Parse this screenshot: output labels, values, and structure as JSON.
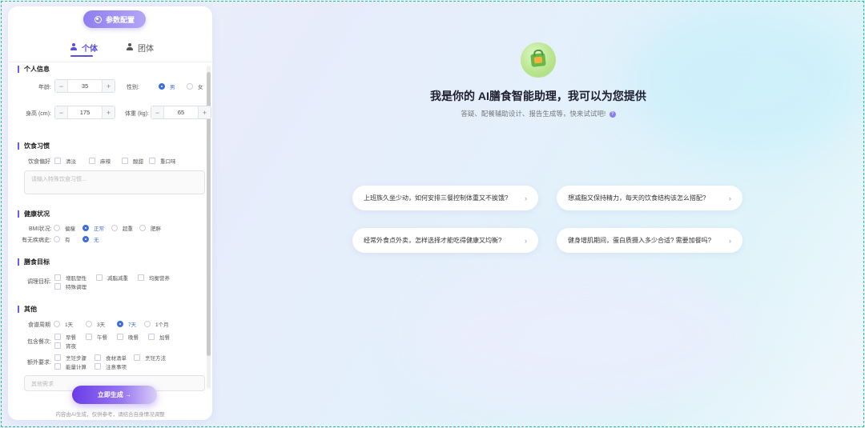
{
  "panel": {
    "param_button": "参数配置",
    "tabs": [
      {
        "label": "个体"
      },
      {
        "label": "团体"
      }
    ],
    "sections": {
      "personal": {
        "title": "个人信息",
        "age_label": "年龄:",
        "age_value": "35",
        "gender_label": "性别:",
        "gender_options": [
          "男",
          "女"
        ],
        "gender_selected": "男",
        "height_label": "身高 (cm):",
        "height_value": "175",
        "weight_label": "体重 (kg):",
        "weight_value": "65"
      },
      "diet": {
        "title": "饮食习惯",
        "pref_label": "饮食偏好",
        "pref_options": [
          "清淡",
          "麻辣",
          "酸甜",
          "重口味"
        ],
        "textarea_placeholder": "请输入特殊饮食习惯..."
      },
      "health": {
        "title": "健康状况",
        "bmi_label": "BMI状况:",
        "bmi_options": [
          "偏瘦",
          "正常",
          "超重",
          "肥胖"
        ],
        "bmi_selected": "正常",
        "disease_label": "有无疾病史:",
        "disease_options": [
          "有",
          "无"
        ],
        "disease_selected": "无"
      },
      "goal": {
        "title": "膳食目标",
        "adjust_label": "调理目标:",
        "options": [
          "增肌塑性",
          "减脂减重",
          "均衡营养",
          "特殊调理"
        ]
      },
      "other": {
        "title": "其他",
        "cycle_label": "食谱周期",
        "cycle_options": [
          "1天",
          "3天",
          "7天",
          "1个月"
        ],
        "cycle_selected": "7天",
        "meals_label": "包含餐次:",
        "meal_options": [
          "早餐",
          "午餐",
          "晚餐",
          "加餐",
          "宵夜"
        ],
        "extra_label": "额外要求:",
        "extra_options": [
          "烹饪步骤",
          "食材清单",
          "烹饪方法",
          "能量计算",
          "注意事项"
        ],
        "extra_placeholder": "其他需求"
      }
    },
    "generate_button": "立即生成 →",
    "disclaimer": "内容由AI生成，仅供参考，请结合自身情况调整"
  },
  "hero": {
    "title": "我是你的 AI膳食智能助理，我可以为您提供",
    "subtitle": "答疑、配餐辅助设计、报告生成等，快来试试吧!",
    "help_icon": "?"
  },
  "suggestions": [
    "上班族久坐少动，如何安排三餐控制体重又不挨饿?",
    "想减脂又保持精力，每天的饮食结构该怎么搭配?",
    "经常外食点外卖，怎样选择才能吃得健康又均衡?",
    "健身增肌期间，蛋白质摄入多少合适? 需要加餐吗?"
  ],
  "colors": {
    "accent": "#6c5ce7",
    "selected": "#3d6de0",
    "frame": "#2bbf8a"
  }
}
